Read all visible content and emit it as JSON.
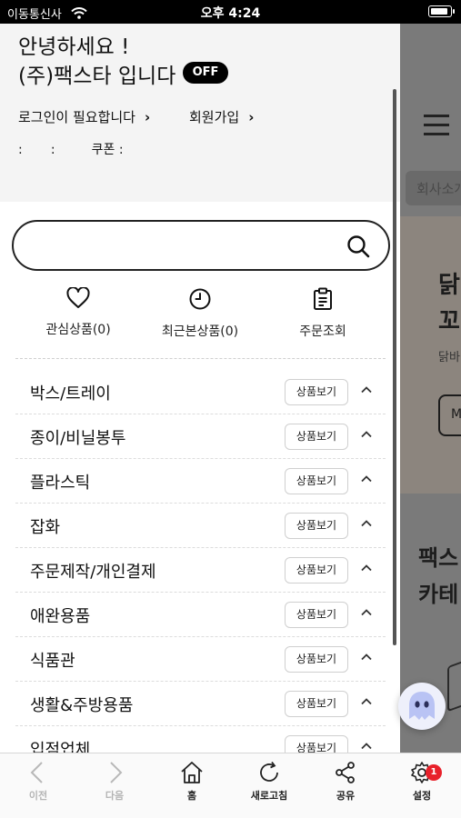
{
  "status_bar": {
    "carrier": "이동통신사",
    "time": "오후 4:24",
    "battery_level": 0.9
  },
  "drawer": {
    "greeting_line1": "안녕하세요 !",
    "greeting_line2": "(주)팩스타 입니다",
    "status_badge": "OFF",
    "login_link": "로그인이 필요합니다",
    "join_link": "회원가입",
    "meta_line": ":       :         쿠폰 :",
    "search": {
      "placeholder": "",
      "value": ""
    },
    "quick_links": [
      {
        "label": "관심상품(0)",
        "icon": "heart-icon"
      },
      {
        "label": "최근본상품(0)",
        "icon": "clock-icon"
      },
      {
        "label": "주문조회",
        "icon": "clipboard-icon"
      }
    ],
    "view_button_label": "상품보기",
    "categories": [
      "박스/트레이",
      "종이/비닐봉투",
      "플라스틱",
      "잡화",
      "주문제작/개인결제",
      "애완용품",
      "식품관",
      "생활&주방용품",
      "입점업체"
    ]
  },
  "background_page": {
    "tab_label": "회사소개",
    "banner_title": "닭\n꼬",
    "banner_sub": "닭바",
    "banner_button": "M",
    "section_title": "팩스\n카테"
  },
  "bottom_nav": {
    "items": [
      {
        "label": "이전",
        "icon": "chevron-left-icon",
        "enabled": false
      },
      {
        "label": "다음",
        "icon": "chevron-right-icon",
        "enabled": false
      },
      {
        "label": "홈",
        "icon": "home-icon",
        "enabled": true
      },
      {
        "label": "새로고침",
        "icon": "refresh-icon",
        "enabled": true
      },
      {
        "label": "공유",
        "icon": "share-icon",
        "enabled": true
      },
      {
        "label": "설정",
        "icon": "gear-icon",
        "enabled": true
      }
    ],
    "settings_badge": "1"
  }
}
